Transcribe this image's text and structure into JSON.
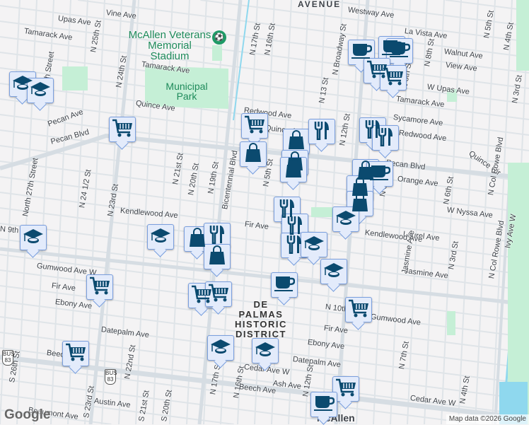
{
  "map": {
    "poi": {
      "stadium": "McAllen Veterans Memorial Stadium",
      "park": "Municipal Park",
      "district": "DE PALMAS HISTORIC DISTRICT",
      "downtown": "McAllen",
      "area": "AVENUE"
    },
    "streets": [
      "Vine Ave",
      "Upas Ave",
      "Tamarack Ave",
      "N 25th St",
      "N 24th St",
      "Tamarack Ave",
      "Quince Ave",
      "Pecan Ave",
      "Pecan Blvd",
      "27th Street",
      "North 27th Street",
      "N 24 1/2 St",
      "N 23rd St",
      "N 21st St",
      "N 20th St",
      "N 19th St",
      "Bicentennial Blvd",
      "Kendlewood Ave",
      "Redwood Ave",
      "Quince Ave",
      "N 17th St",
      "N 16th St",
      "Westway Ave",
      "La Vista Ave",
      "Walnut Ave",
      "View Ave",
      "W Upas Ave",
      "Tamarack Ave",
      "Sycamore Ave",
      "Redwood Ave",
      "N Broadway St",
      "N 13 St",
      "N 12th St",
      "N 8th St",
      "N 5th St",
      "N 4th St",
      "N 3rd St",
      "Quince Cir",
      "Pecan Blvd",
      "Orange Ave",
      "W Nyssa Ave",
      "N 6th St",
      "N Col Rowe Blvd",
      "Laurel Ave",
      "Jasmine Ave",
      "Gumwood Ave W",
      "Fir Ave",
      "Ebony Ave",
      "Datepalm Ave",
      "Beech Ave",
      "S 26th St",
      "S 23rd St",
      "Austin Ave",
      "Beaumont Ave",
      "N 22nd St",
      "S 21st St",
      "S 20th St",
      "N 17th St",
      "N 16th St",
      "Beech Ave",
      "Cedar Ave W",
      "Ash Ave",
      "N 12th St",
      "Gumwood Ave",
      "Fir Ave",
      "Ebony Ave",
      "Datepalm Ave",
      "N 7th St",
      "N 4th St",
      "Cedar Ave W",
      "N 8th St",
      "Jasmine Ave",
      "Kendlewood Ave",
      "Fir Ave",
      "N 10th St",
      "N 5th St",
      "N 3rd St",
      "N Col Rowe Blvd",
      "Ivy Ave W",
      "N 9th St",
      "N 6th St"
    ],
    "shields": [
      "BUS 83",
      "BUS 83"
    ],
    "markers": [
      "education",
      "education",
      "grocery",
      "grocery",
      "shopping",
      "shopping",
      "restaurant",
      "shopping",
      "shopping",
      "restaurant",
      "restaurant",
      "cafe",
      "cafe",
      "cafe",
      "grocery",
      "grocery",
      "shopping",
      "cafe",
      "shopping",
      "shopping",
      "education",
      "restaurant",
      "restaurant",
      "restaurant",
      "education",
      "education",
      "cafe",
      "grocery",
      "education",
      "education",
      "shopping",
      "restaurant",
      "shopping",
      "grocery",
      "grocery",
      "grocery",
      "education",
      "education",
      "grocery",
      "grocery",
      "cafe"
    ],
    "logo": "Google",
    "attribution": "Map data ©2026 Google"
  },
  "colors": {
    "marker_fill": "#e3ebfb",
    "marker_border": "#7a9fde",
    "icon": "#0b4a6f",
    "park": "#c5efd6",
    "road": "#d6dde3",
    "water": "#8fd8ee"
  }
}
